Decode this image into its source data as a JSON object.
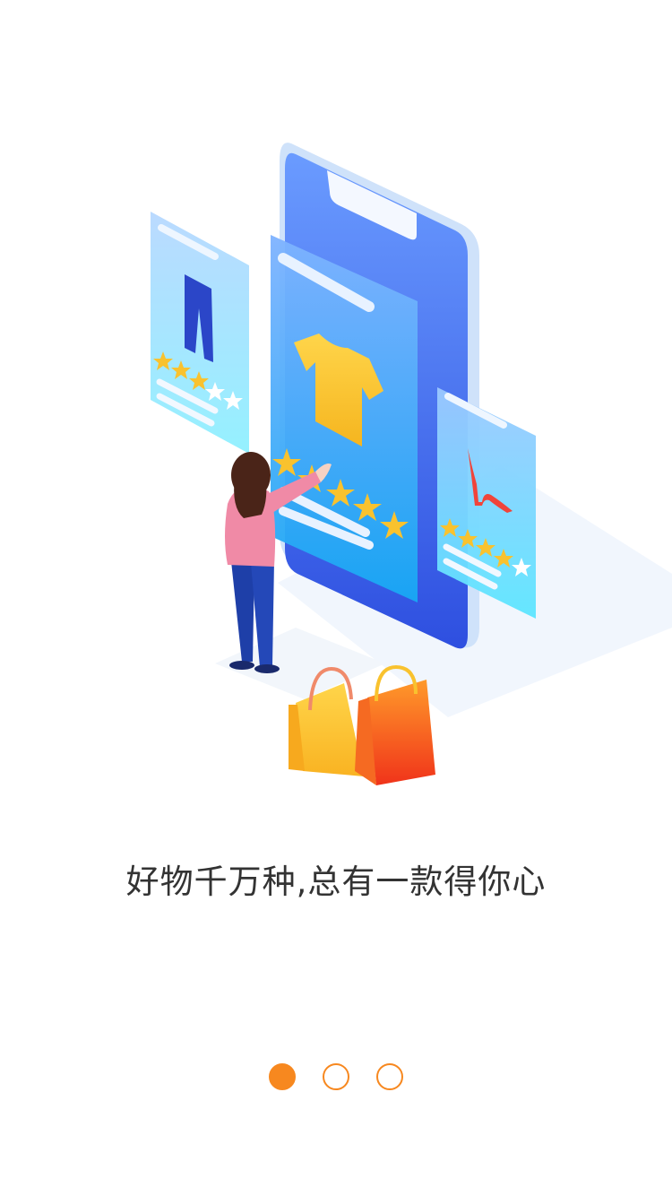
{
  "onboarding": {
    "slogan": "好物千万种,总有一款得你心",
    "illustration_icon": "shopping-phone-illustration",
    "pager": {
      "total": 3,
      "active": 0,
      "accent_color": "#F7881F"
    }
  },
  "colors": {
    "background": "#FFFFFF",
    "text": "#333333",
    "phone_blue": "#3D6CF0",
    "star_yellow": "#F9C22E",
    "bag_orange": "#F55A1E"
  }
}
